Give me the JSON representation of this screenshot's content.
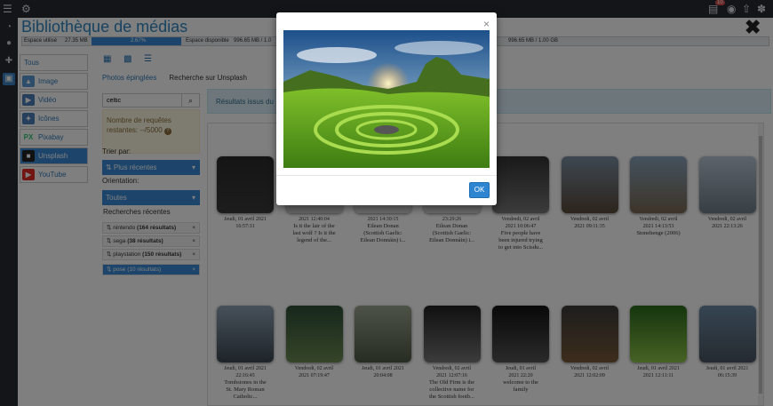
{
  "topbar": {
    "menu_icon": "hamburger-icon",
    "settings_icon": "gears-icon",
    "notif_count": "10",
    "clipboard_icon": "clipboard-icon",
    "eye_icon": "eye-icon",
    "upload_icon": "upload-icon",
    "logo_icon": "joomla-logo-icon"
  },
  "sidebar": {
    "items": [
      {
        "icon": "dashboard-icon"
      },
      {
        "icon": "user-icon"
      },
      {
        "icon": "puzzle-icon"
      },
      {
        "icon": "images-icon",
        "active": true
      }
    ]
  },
  "header": {
    "title": "Bibliothèque de médias",
    "close": "✖"
  },
  "disk": {
    "used_label": "Espace utilisé",
    "used_value": "27.35 MB",
    "percent": "2.67%",
    "percent_fraction": 0.0267,
    "free_label": "Espace disponible",
    "free_value": "996.65 MB / 1.0",
    "right_value": "996.65 MB / 1.00 GB"
  },
  "categories": [
    {
      "label": "Tous",
      "icon": "",
      "color": ""
    },
    {
      "label": "Image",
      "icon": "image-icon",
      "color": "#5b9bd5"
    },
    {
      "label": "Vidéo",
      "icon": "video-icon",
      "color": "#4a7ebb"
    },
    {
      "label": "Icônes",
      "icon": "icons-icon",
      "color": "#4a7ebb"
    },
    {
      "label": "Pixabay",
      "icon": "pixabay-icon",
      "color": "#2ec66d",
      "icon_text": "PX"
    },
    {
      "label": "Unsplash",
      "icon": "unsplash-icon",
      "color": "#222222",
      "active": true
    },
    {
      "label": "YouTube",
      "icon": "youtube-icon",
      "color": "#e52d27"
    }
  ],
  "view_icons": [
    "grid-small-icon",
    "grid-large-icon",
    "list-icon"
  ],
  "tabs": [
    "Photos épinglées",
    "Recherche sur Unsplash"
  ],
  "search": {
    "value": "celtic",
    "icon": "search-icon"
  },
  "quota": {
    "text": "Nombre de requêtes restantes: --/5000",
    "help": "?"
  },
  "sort": {
    "label": "Trier par:",
    "value": "⇅ Plus récentes"
  },
  "orientation": {
    "label": "Orientation:",
    "value": "Toutes"
  },
  "recent": {
    "label": "Recherches récentes",
    "items": [
      {
        "term": "nintendo",
        "count": "(164 résultats)"
      },
      {
        "term": "sega",
        "count": "(38 résultats)"
      },
      {
        "term": "playstation",
        "count": "(150 résultats)"
      },
      {
        "term": "pose",
        "count": "(10 résultats)",
        "active": true
      }
    ]
  },
  "banner": {
    "text": "Résultats issus du"
  },
  "row1": [
    {
      "l1": "Jeudi, 01 avril 2021",
      "l2": "16:57:31",
      "l3": "",
      "l4": "",
      "l5": ""
    },
    {
      "l1": "",
      "l2": "2021 12:40:04",
      "l3": "Is it the lair of the",
      "l4": "last wolf ? Is it the",
      "l5": "legend of the..."
    },
    {
      "l1": "",
      "l2": "2021 14:30:15",
      "l3": "Eilean Donan",
      "l4": "(Scottish Gaelic:",
      "l5": "Eilean Donnáin) i..."
    },
    {
      "l1": "",
      "l2": "23:29:26",
      "l3": "Eilean Donan",
      "l4": "(Scottish Gaelic:",
      "l5": "Eilean Donnáin) i..."
    },
    {
      "l1": "Vendredi, 02 avril",
      "l2": "2021 10:06:47",
      "l3": "Five people have",
      "l4": "been injured trying",
      "l5": "to get into Scisdu..."
    },
    {
      "l1": "Vendredi, 02 avril",
      "l2": "2021 09:11:35",
      "l3": "",
      "l4": "",
      "l5": ""
    },
    {
      "l1": "Vendredi, 02 avril",
      "l2": "2021 14:13:53",
      "l3": "Stonehenge (2006)",
      "l4": "",
      "l5": ""
    },
    {
      "l1": "Vendredi, 02 avril",
      "l2": "2021 22:13:26",
      "l3": "",
      "l4": "",
      "l5": ""
    }
  ],
  "row2": [
    {
      "l1": "Jeudi, 01 avril 2021",
      "l2": "22:16:45",
      "l3": "Tombstones in the",
      "l4": "St. Mary Roman",
      "l5": "Catholic..."
    },
    {
      "l1": "Vendredi, 02 avril",
      "l2": "2021 07:19:47",
      "l3": "",
      "l4": "",
      "l5": ""
    },
    {
      "l1": "Jeudi, 01 avril 2021",
      "l2": "20:04:08",
      "l3": "",
      "l4": "",
      "l5": ""
    },
    {
      "l1": "Vendredi, 02 avril",
      "l2": "2021 12:07:16",
      "l3": "The Old Firm is the",
      "l4": "collective name for",
      "l5": "the Scottish footb..."
    },
    {
      "l1": "Jeudi, 01 avril",
      "l2": "2021 22:20",
      "l3": "welcome to the",
      "l4": "family",
      "l5": ""
    },
    {
      "l1": "Vendredi, 02 avril",
      "l2": "2021 12:02:09",
      "l3": "",
      "l4": "",
      "l5": ""
    },
    {
      "l1": "Jeudi, 01 avril 2021",
      "l2": "2021 12:11:11",
      "l3": "",
      "l4": "",
      "l5": ""
    },
    {
      "l1": "Jeudi, 01 avril 2021",
      "l2": "06:15:39",
      "l3": "",
      "l4": "",
      "l5": ""
    }
  ],
  "modal": {
    "close": "×",
    "ok": "OK",
    "image": "celtic-hills-spiral-photo"
  }
}
